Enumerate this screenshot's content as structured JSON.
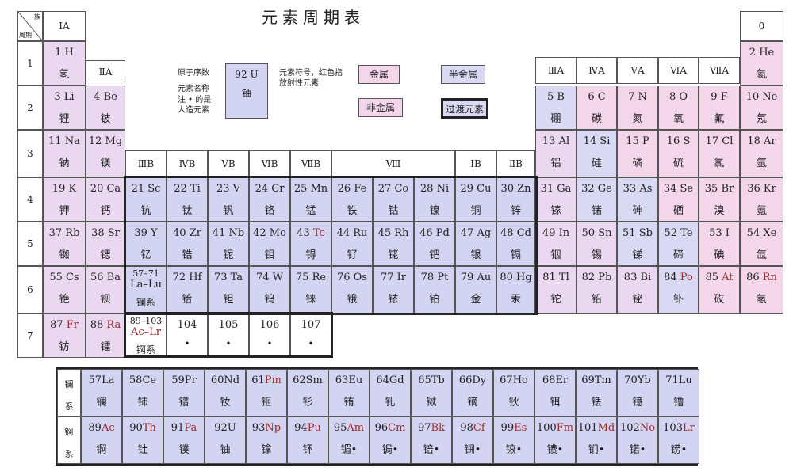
{
  "title": "元素周期表",
  "corner": {
    "top": "族",
    "bottom": "周期"
  },
  "group_headers": {
    "IA": "ⅠA",
    "IIA": "ⅡA",
    "IIIA": "ⅢA",
    "IVA": "ⅣA",
    "VA": "ⅤA",
    "VIA": "ⅥA",
    "VIIA": "ⅦA",
    "0": "0",
    "IIIB": "ⅢB",
    "IVB": "ⅣB",
    "VB": "ⅤB",
    "VIB": "ⅥB",
    "VIIB": "ⅦB",
    "VIII": "Ⅷ",
    "IB": "ⅠB",
    "IIB": "ⅡB"
  },
  "periods": [
    "1",
    "2",
    "3",
    "4",
    "5",
    "6",
    "7"
  ],
  "legend": {
    "atomic_number_label": "原子序数",
    "name_label": "元素名称",
    "note_label": "注 • 的是人造元素",
    "symbol_label": "元素符号，红色指放射性元素",
    "sample_number": "92",
    "sample_symbol": "U",
    "sample_name": "铀",
    "metal": "金属",
    "semimetal": "半金属",
    "nonmetal": "非金属",
    "transition": "过渡元素"
  },
  "elements": {
    "H": {
      "n": "1",
      "s": "H",
      "c": "氢"
    },
    "He": {
      "n": "2",
      "s": "He",
      "c": "氦"
    },
    "Li": {
      "n": "3",
      "s": "Li",
      "c": "锂"
    },
    "Be": {
      "n": "4",
      "s": "Be",
      "c": "铍"
    },
    "B": {
      "n": "5",
      "s": "B",
      "c": "硼"
    },
    "C": {
      "n": "6",
      "s": "C",
      "c": "碳"
    },
    "N": {
      "n": "7",
      "s": "N",
      "c": "氮"
    },
    "O": {
      "n": "8",
      "s": "O",
      "c": "氧"
    },
    "F": {
      "n": "9",
      "s": "F",
      "c": "氟"
    },
    "Ne": {
      "n": "10",
      "s": "Ne",
      "c": "氖"
    },
    "Na": {
      "n": "11",
      "s": "Na",
      "c": "钠"
    },
    "Mg": {
      "n": "12",
      "s": "Mg",
      "c": "镁"
    },
    "Al": {
      "n": "13",
      "s": "Al",
      "c": "铝"
    },
    "Si": {
      "n": "14",
      "s": "Si",
      "c": "硅"
    },
    "P": {
      "n": "15",
      "s": "P",
      "c": "磷"
    },
    "S": {
      "n": "16",
      "s": "S",
      "c": "硫"
    },
    "Cl": {
      "n": "17",
      "s": "Cl",
      "c": "氯"
    },
    "Ar": {
      "n": "18",
      "s": "Ar",
      "c": "氩"
    },
    "K": {
      "n": "19",
      "s": "K",
      "c": "钾"
    },
    "Ca": {
      "n": "20",
      "s": "Ca",
      "c": "钙"
    },
    "Sc": {
      "n": "21",
      "s": "Sc",
      "c": "钪"
    },
    "Ti": {
      "n": "22",
      "s": "Ti",
      "c": "钛"
    },
    "V": {
      "n": "23",
      "s": "V",
      "c": "钒"
    },
    "Cr": {
      "n": "24",
      "s": "Cr",
      "c": "铬"
    },
    "Mn": {
      "n": "25",
      "s": "Mn",
      "c": "锰"
    },
    "Fe": {
      "n": "26",
      "s": "Fe",
      "c": "铁"
    },
    "Co": {
      "n": "27",
      "s": "Co",
      "c": "钴"
    },
    "Ni": {
      "n": "28",
      "s": "Ni",
      "c": "镍"
    },
    "Cu": {
      "n": "29",
      "s": "Cu",
      "c": "铜"
    },
    "Zn": {
      "n": "30",
      "s": "Zn",
      "c": "锌"
    },
    "Ga": {
      "n": "31",
      "s": "Ga",
      "c": "镓"
    },
    "Ge": {
      "n": "32",
      "s": "Ge",
      "c": "锗"
    },
    "As": {
      "n": "33",
      "s": "As",
      "c": "砷"
    },
    "Se": {
      "n": "34",
      "s": "Se",
      "c": "硒"
    },
    "Br": {
      "n": "35",
      "s": "Br",
      "c": "溴"
    },
    "Kr": {
      "n": "36",
      "s": "Kr",
      "c": "氪"
    },
    "Rb": {
      "n": "37",
      "s": "Rb",
      "c": "铷"
    },
    "Sr": {
      "n": "38",
      "s": "Sr",
      "c": "锶"
    },
    "Y": {
      "n": "39",
      "s": "Y",
      "c": "钇"
    },
    "Zr": {
      "n": "40",
      "s": "Zr",
      "c": "锆"
    },
    "Nb": {
      "n": "41",
      "s": "Nb",
      "c": "铌"
    },
    "Mo": {
      "n": "42",
      "s": "Mo",
      "c": "钼"
    },
    "Tc": {
      "n": "43",
      "s": "Tc",
      "c": "锝"
    },
    "Ru": {
      "n": "44",
      "s": "Ru",
      "c": "钌"
    },
    "Rh": {
      "n": "45",
      "s": "Rh",
      "c": "铑"
    },
    "Pd": {
      "n": "46",
      "s": "Pd",
      "c": "钯"
    },
    "Ag": {
      "n": "47",
      "s": "Ag",
      "c": "银"
    },
    "Cd": {
      "n": "48",
      "s": "Cd",
      "c": "镉"
    },
    "In": {
      "n": "49",
      "s": "In",
      "c": "铟"
    },
    "Sn": {
      "n": "50",
      "s": "Sn",
      "c": "锡"
    },
    "Sb": {
      "n": "51",
      "s": "Sb",
      "c": "锑"
    },
    "Te": {
      "n": "52",
      "s": "Te",
      "c": "碲"
    },
    "I": {
      "n": "53",
      "s": "I",
      "c": "碘"
    },
    "Xe": {
      "n": "54",
      "s": "Xe",
      "c": "氙"
    },
    "Cs": {
      "n": "55",
      "s": "Cs",
      "c": "铯"
    },
    "Ba": {
      "n": "56",
      "s": "Ba",
      "c": "钡"
    },
    "LaLu": {
      "n": "57–71",
      "s": "La–Lu",
      "c": "镧系"
    },
    "Hf": {
      "n": "72",
      "s": "Hf",
      "c": "铪"
    },
    "Ta": {
      "n": "73",
      "s": "Ta",
      "c": "钽"
    },
    "W": {
      "n": "74",
      "s": "W",
      "c": "钨"
    },
    "Re": {
      "n": "75",
      "s": "Re",
      "c": "铼"
    },
    "Os": {
      "n": "76",
      "s": "Os",
      "c": "锇"
    },
    "Ir": {
      "n": "77",
      "s": "Ir",
      "c": "铱"
    },
    "Pt": {
      "n": "78",
      "s": "Pt",
      "c": "铂"
    },
    "Au": {
      "n": "79",
      "s": "Au",
      "c": "金"
    },
    "Hg": {
      "n": "80",
      "s": "Hg",
      "c": "汞"
    },
    "Tl": {
      "n": "81",
      "s": "Tl",
      "c": "铊"
    },
    "Pb": {
      "n": "82",
      "s": "Pb",
      "c": "铅"
    },
    "Bi": {
      "n": "83",
      "s": "Bi",
      "c": "铋"
    },
    "Po": {
      "n": "84",
      "s": "Po",
      "c": "钋"
    },
    "At": {
      "n": "85",
      "s": "At",
      "c": "砹"
    },
    "Rn": {
      "n": "86",
      "s": "Rn",
      "c": "氡"
    },
    "Fr": {
      "n": "87",
      "s": "Fr",
      "c": "钫"
    },
    "Ra": {
      "n": "88",
      "s": "Ra",
      "c": "镭"
    },
    "AcLr": {
      "n": "89–103",
      "s": "Ac–Lr",
      "c": "锕系"
    },
    "E104": {
      "n": "104",
      "s": "",
      "c": "•"
    },
    "E105": {
      "n": "105",
      "s": "",
      "c": "•"
    },
    "E106": {
      "n": "106",
      "s": "",
      "c": "•"
    },
    "E107": {
      "n": "107",
      "s": "",
      "c": "•"
    }
  },
  "lanthanides_label": "镧系",
  "actinides_label": "锕系",
  "lanthanides": [
    {
      "n": "57",
      "s": "La",
      "c": "镧"
    },
    {
      "n": "58",
      "s": "Ce",
      "c": "铈"
    },
    {
      "n": "59",
      "s": "Pr",
      "c": "镨"
    },
    {
      "n": "60",
      "s": "Nd",
      "c": "钕"
    },
    {
      "n": "61",
      "s": "Pm",
      "c": "钷"
    },
    {
      "n": "62",
      "s": "Sm",
      "c": "钐"
    },
    {
      "n": "63",
      "s": "Eu",
      "c": "铕"
    },
    {
      "n": "64",
      "s": "Gd",
      "c": "钆"
    },
    {
      "n": "65",
      "s": "Tb",
      "c": "铽"
    },
    {
      "n": "66",
      "s": "Dy",
      "c": "镝"
    },
    {
      "n": "67",
      "s": "Ho",
      "c": "钬"
    },
    {
      "n": "68",
      "s": "Er",
      "c": "铒"
    },
    {
      "n": "69",
      "s": "Tm",
      "c": "铥"
    },
    {
      "n": "70",
      "s": "Yb",
      "c": "镱"
    },
    {
      "n": "71",
      "s": "Lu",
      "c": "镥"
    }
  ],
  "actinides": [
    {
      "n": "89",
      "s": "Ac",
      "c": "锕"
    },
    {
      "n": "90",
      "s": "Th",
      "c": "钍"
    },
    {
      "n": "91",
      "s": "Pa",
      "c": "镤"
    },
    {
      "n": "92",
      "s": "U",
      "c": "铀"
    },
    {
      "n": "93",
      "s": "Np",
      "c": "镎"
    },
    {
      "n": "94",
      "s": "Pu",
      "c": "钚"
    },
    {
      "n": "95",
      "s": "Am",
      "c": "镅•"
    },
    {
      "n": "96",
      "s": "Cm",
      "c": "锔•"
    },
    {
      "n": "97",
      "s": "Bk",
      "c": "锫•"
    },
    {
      "n": "98",
      "s": "Cf",
      "c": "锎•"
    },
    {
      "n": "99",
      "s": "Es",
      "c": "锿•"
    },
    {
      "n": "100",
      "s": "Fm",
      "c": "镄•"
    },
    {
      "n": "101",
      "s": "Md",
      "c": "钔•"
    },
    {
      "n": "102",
      "s": "No",
      "c": "锘•"
    },
    {
      "n": "103",
      "s": "Lr",
      "c": "铹•"
    }
  ],
  "colors": {
    "metal": "#ead8f0",
    "nonmetal": "#f3d6ea",
    "semimetal": "#d9d9f3",
    "transition": "#d2d4f1",
    "radioactive": "#9b2b2b"
  }
}
